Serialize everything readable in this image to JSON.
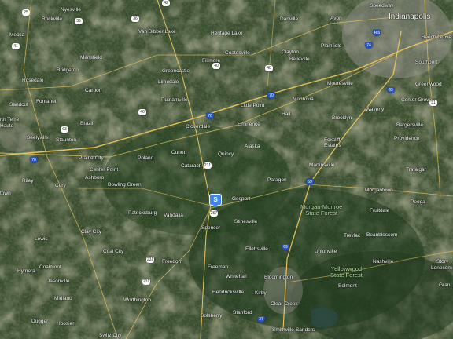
{
  "map": {
    "type": "satellite",
    "places": {
      "indianapolis": "Indianapolis",
      "speedway": "Speedway",
      "avon": "Avon",
      "danville": "Danville",
      "nyesville": "Nyesville",
      "rockville": "Rockville",
      "mecca": "Mecca",
      "van_bibber_lake": "Van Bibber Lake",
      "heritage_lake": "Heritage Lake",
      "plainfield": "Plainfield",
      "beech_grove": "Beech Grove",
      "southport": "Southport",
      "greenwood": "Greenwood",
      "mansfield": "Mansfield",
      "coatesville": "Coatesville",
      "clayton": "Clayton",
      "belleville": "Belleville",
      "fillmore": "Fillmore",
      "greencastle": "Greencastle",
      "bridgeton": "Bridgeton",
      "rosedale": "Rosedale",
      "limedale": "Limedale",
      "carbon": "Carbon",
      "putnamville": "Putnamville",
      "mooresville": "Mooresville",
      "monrovia": "Monrovia",
      "little_point": "Little Point",
      "center_grove": "Center Grove",
      "sandcut": "Sandcut",
      "fontanet": "Fontanet",
      "north_terre": "rth Terre",
      "haute": "Haute",
      "brazil": "Brazil",
      "cloverdale": "Cloverdale",
      "hall": "Hall",
      "brooklyn": "Brooklyn",
      "waverly": "Waverly",
      "bargersville": "Bargersville",
      "eminence": "Eminence",
      "seelyville": "Seelyville",
      "staunton": "Staunton",
      "providence": "Providence",
      "alaska": "Alaska",
      "foxcliff_estates": "Foxcliff\nEstates",
      "cunot": "Cunot",
      "poland": "Poland",
      "prairie_city": "Prairie City",
      "quincy": "Quincy",
      "martinsville": "Martinsville",
      "trafalgar": "Trafalgar",
      "cataract": "Cataract",
      "center_point": "Center Point",
      "riley": "Riley",
      "ashboro": "Ashboro",
      "paragon": "Paragon",
      "cory": "Cory",
      "bowling_green": "Bowling Green",
      "morgantown": "Morgantown",
      "town": "town",
      "gosport": "Gosport",
      "peoga": "Peoga",
      "fruitdale": "Fruitdale",
      "patricksburg": "Patricksburg",
      "vandalia": "Vandalia",
      "stinesville": "Stinesville",
      "spencer": "Spencer",
      "trevlac": "Trevlac",
      "beanblossom": "Beanblossom",
      "lewis": "Lewis",
      "clay_city": "Clay City",
      "ellettsville": "Ellettsville",
      "unionville": "Unionville",
      "coal_city": "Coal City",
      "nashville": "Nashville",
      "freedom": "Freedom",
      "story": "Story",
      "lonesom": "Lonesom",
      "hymera": "Hymera",
      "coalmont": "Coalmont",
      "freeman": "Freeman",
      "whitehall": "Whitehall",
      "bloomington": "Bloomington",
      "jasonville": "Jasonville",
      "hendricksville": "Hendricksville",
      "kirby": "Kirby",
      "belmont": "Belmont",
      "grand": "Gran",
      "midland": "Midland",
      "worthington": "Worthington",
      "clear_creek": "Clear Creek",
      "solsberry": "Solsberry",
      "stanford": "Stanford",
      "dugger": "Dugger",
      "hoosier": "Hoosier",
      "smithville_sanders": "Smithville-Sanders",
      "switz_city": "Switz City",
      "morgan_monroe": "Morgan-Monroe\nState Forest",
      "yellowwood": "Yellowwood\nState Forest"
    },
    "shields": {
      "s36": "36",
      "s39": "39",
      "s41a": "41",
      "s63": "63",
      "s40a": "40",
      "s40b": "40",
      "s40c": "40",
      "s70a": "70",
      "s70b": "70",
      "s70c": "70",
      "s65": "65",
      "s31": "31",
      "s46": "46",
      "s42": "42",
      "s231a": "231",
      "s231b": "231",
      "s231c": "231",
      "s67": "67",
      "s69": "69",
      "s69b": "69",
      "s37": "37",
      "s465": "465",
      "s470": "74",
      "s25": "25",
      "s267": "267"
    },
    "marker": {
      "label": "S",
      "color": "#3f86e6"
    }
  }
}
